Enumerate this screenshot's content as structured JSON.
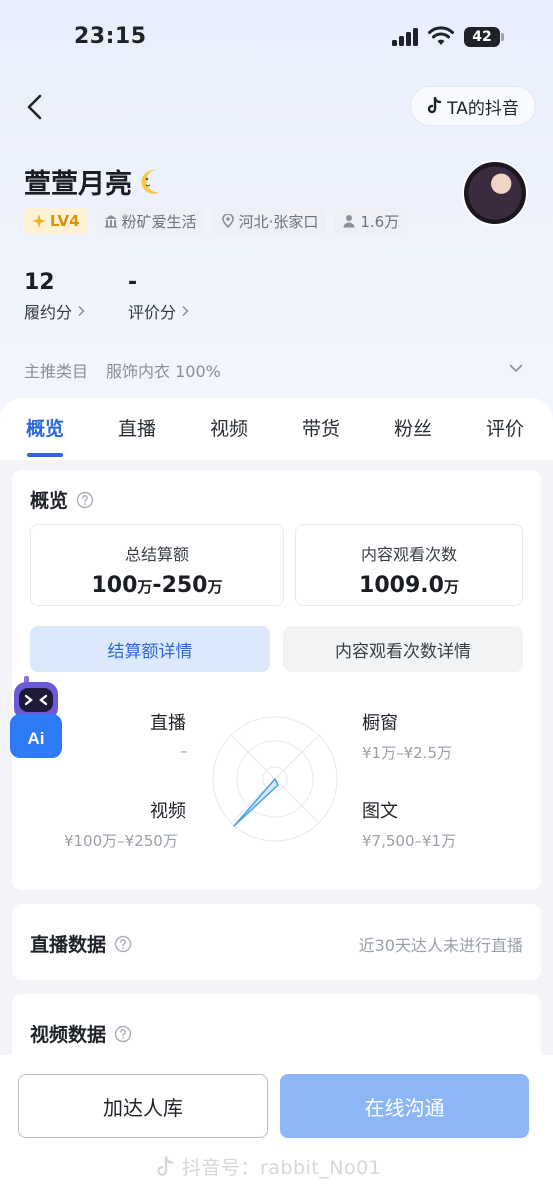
{
  "status_bar": {
    "time": "23:15",
    "battery": "42"
  },
  "header": {
    "ta_douyin_label": "TA的抖音"
  },
  "profile": {
    "name": "萱萱月亮",
    "level": "LV4",
    "tags": [
      "粉矿爱生活",
      "河北·张家口",
      "1.6万"
    ],
    "stats": [
      {
        "value": "12",
        "label": "履约分"
      },
      {
        "value": "-",
        "label": "评价分"
      }
    ],
    "category_label": "主推类目",
    "category_value": "服饰内衣 100%"
  },
  "tabs": [
    "概览",
    "直播",
    "视频",
    "带货",
    "粉丝",
    "评价"
  ],
  "overview": {
    "title": "概览",
    "metrics": [
      {
        "label": "总结算额",
        "value_a": "100",
        "unit_a": "万",
        "sep": "-",
        "value_b": "250",
        "unit_b": "万"
      },
      {
        "label": "内容观看次数",
        "value": "1009.0",
        "unit": "万"
      }
    ],
    "toggles": [
      "结算额详情",
      "内容观看次数详情"
    ],
    "radar": {
      "live_label": "直播",
      "live_value": "–",
      "window_label": "橱窗",
      "window_value": "¥1万–¥2.5万",
      "video_label": "视频",
      "video_value": "¥100万–¥250万",
      "text_label": "图文",
      "text_value": "¥7,500–¥1万"
    },
    "ai_label": "Ai"
  },
  "live_section": {
    "title": "直播数据",
    "note": "近30天达人未进行直播"
  },
  "video_section": {
    "title": "视频数据"
  },
  "actions": {
    "add_label": "加达人库",
    "chat_label": "在线沟通"
  },
  "watermark": "抖音号：rabbit_No01",
  "colors": {
    "accent": "#2c69d8",
    "chat_button": "#8db6f7",
    "level_badge": "#d9930b"
  }
}
